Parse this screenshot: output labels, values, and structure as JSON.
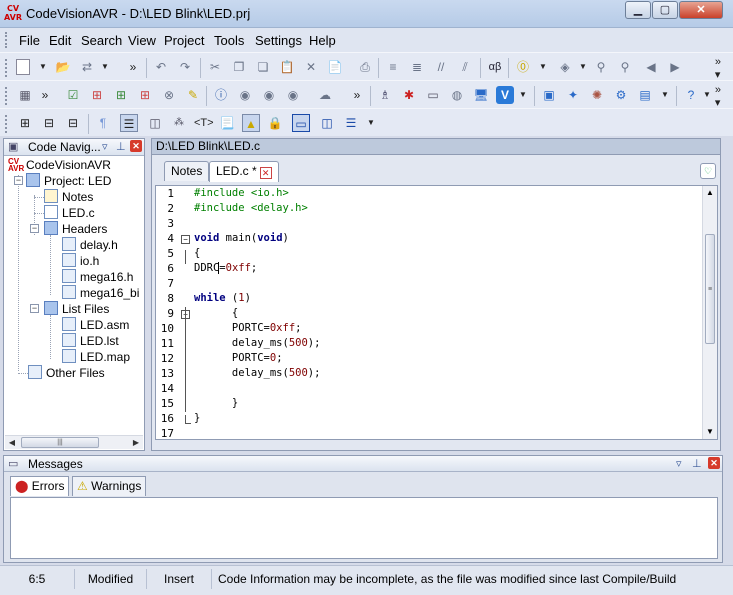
{
  "window": {
    "title": "CodeVisionAVR - D:\\LED Blink\\LED.prj",
    "logo_text": "CV AVR",
    "buttons": {
      "minimize": "▁",
      "maximize": "▢",
      "close": "✕"
    }
  },
  "menu": [
    "File",
    "Edit",
    "Search",
    "View",
    "Project",
    "Tools",
    "Settings",
    "Help"
  ],
  "code_navigator": {
    "title": "Code Navig...",
    "tree": {
      "root": "CodeVisionAVR",
      "project": "Project: LED",
      "notes": "Notes",
      "main_file": "LED.c",
      "headers_label": "Headers",
      "headers": [
        "delay.h",
        "io.h",
        "mega16.h",
        "mega16_bi"
      ],
      "list_files_label": "List Files",
      "list_files": [
        "LED.asm",
        "LED.lst",
        "LED.map"
      ],
      "other_files": "Other Files"
    }
  },
  "editor": {
    "path": "D:\\LED Blink\\LED.c",
    "tabs": [
      "Notes",
      "LED.c *"
    ],
    "active_tab": "LED.c *",
    "lines": [
      "#include <io.h>",
      "#include <delay.h>",
      "",
      "void main(void)",
      "{",
      "DDRC=0xff;",
      "",
      "while (1)",
      "      {",
      "      PORTC=0xff;",
      "      delay_ms(500);",
      "      PORTC=0;",
      "      delay_ms(500);",
      "",
      "      }",
      "}",
      ""
    ],
    "fold_lines": [
      4,
      5,
      9,
      16
    ]
  },
  "messages": {
    "title": "Messages",
    "tabs": [
      "Errors",
      "Warnings"
    ],
    "active_tab": "Errors"
  },
  "status": {
    "position": "6:5",
    "modified": "Modified",
    "mode": "Insert",
    "info": "Code Information may be incomplete, as the file was modified since last Compile/Build"
  },
  "colors": {
    "keyword": "#00007f",
    "preprocessor": "#008000",
    "number": "#7f0000"
  }
}
